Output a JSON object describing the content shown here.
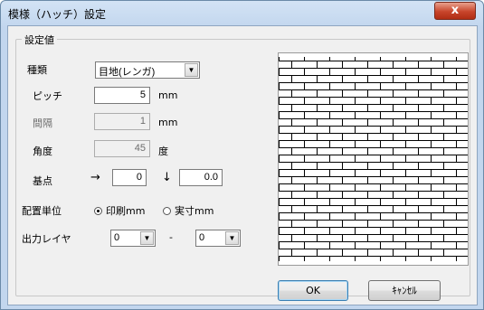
{
  "window": {
    "title": "模様（ハッチ）設定",
    "close_glyph": "x"
  },
  "group": {
    "legend": "設定値"
  },
  "type": {
    "label": "種類",
    "value": "目地(レンガ)"
  },
  "pitch": {
    "label": "ピッチ",
    "value": "5",
    "unit": "mm"
  },
  "spacing": {
    "label": "間隔",
    "value": "1",
    "unit": "mm"
  },
  "angle": {
    "label": "角度",
    "value": "45",
    "unit": "度"
  },
  "base_point": {
    "label": "基点",
    "arrow_right": "→",
    "x_value": "0",
    "arrow_down": "↓",
    "y_value": "0.0"
  },
  "placement_unit": {
    "label": "配置単位",
    "options": [
      {
        "label": "印刷mm",
        "selected": true
      },
      {
        "label": "実寸mm",
        "selected": false
      }
    ]
  },
  "output_layer": {
    "label": "出力レイヤ",
    "from_value": "0",
    "separator": "-",
    "to_value": "0"
  },
  "combo_arrow": "▼",
  "preview": {
    "pattern": "brick"
  },
  "buttons": {
    "ok": "OK",
    "cancel": "ｷｬﾝｾﾙ"
  }
}
